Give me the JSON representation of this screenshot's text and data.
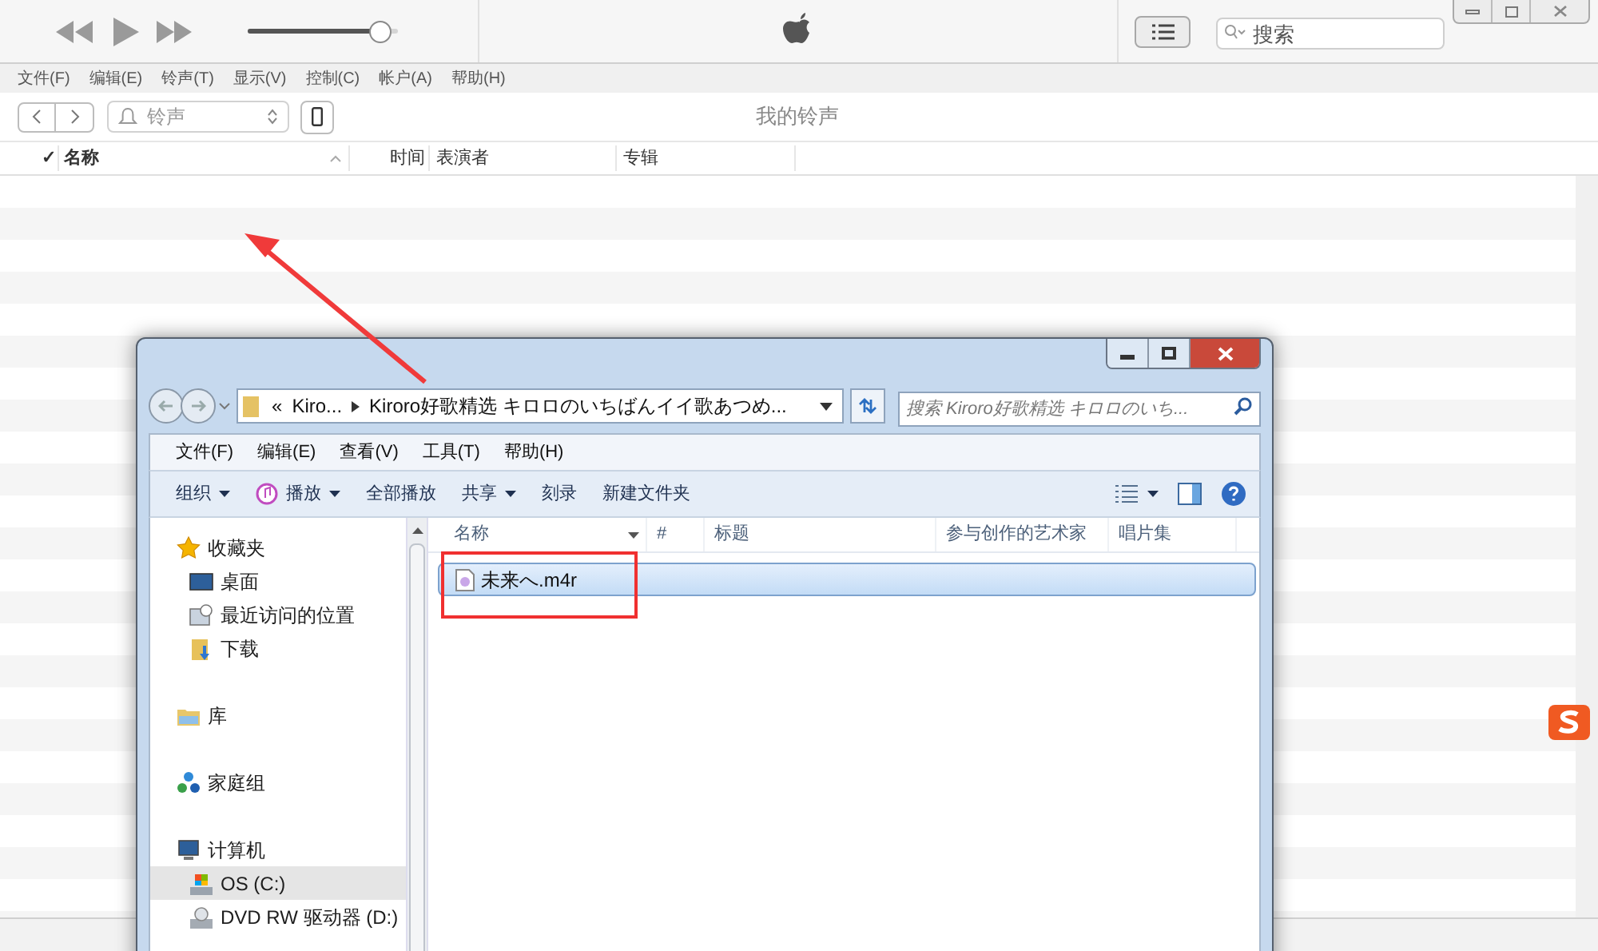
{
  "itunes": {
    "volume": {
      "level": 0.88
    },
    "search": {
      "placeholder": "搜索"
    },
    "menu": [
      "文件(F)",
      "编辑(E)",
      "铃声(T)",
      "显示(V)",
      "控制(C)",
      "帐户(A)",
      "帮助(H)"
    ],
    "source": "铃声",
    "title": "我的铃声",
    "columns": [
      {
        "label": "✓",
        "kind": "check"
      },
      {
        "label": "名称",
        "kind": "sorted"
      },
      {
        "label": "时间",
        "kind": "right"
      },
      {
        "label": "表演者",
        "kind": "plain"
      },
      {
        "label": "专辑",
        "kind": "plain"
      }
    ]
  },
  "explorer": {
    "breadcrumb": [
      "«",
      "Kiro...",
      "Kiroro好歌精选 キロロのいちばんイイ歌あつめ..."
    ],
    "search": {
      "placeholder": "搜索 Kiroro好歌精选 キロロのいち..."
    },
    "menu": [
      "文件(F)",
      "编辑(E)",
      "查看(V)",
      "工具(T)",
      "帮助(H)"
    ],
    "toolbar": [
      {
        "label": "组织",
        "has_menu": true,
        "kind": "plain"
      },
      {
        "label": "播放",
        "has_menu": true,
        "kind": "music"
      },
      {
        "label": "全部播放",
        "has_menu": false,
        "kind": "plain"
      },
      {
        "label": "共享",
        "has_menu": true,
        "kind": "plain"
      },
      {
        "label": "刻录",
        "has_menu": false,
        "kind": "plain"
      },
      {
        "label": "新建文件夹",
        "has_menu": false,
        "kind": "plain"
      }
    ],
    "nav": [
      {
        "label": "收藏夹",
        "kind": "star",
        "selected": false,
        "children": [
          {
            "label": "桌面",
            "kind": "desktop",
            "selected": false
          },
          {
            "label": "最近访问的位置",
            "kind": "recent",
            "selected": false
          },
          {
            "label": "下载",
            "kind": "download",
            "selected": false
          }
        ]
      },
      {
        "label": "库",
        "kind": "library",
        "selected": false
      },
      {
        "label": "家庭组",
        "kind": "homegroup",
        "selected": false
      },
      {
        "label": "计算机",
        "kind": "computer",
        "selected": false,
        "children": [
          {
            "label": "OS (C:)",
            "kind": "drive",
            "selected": true
          },
          {
            "label": "DVD RW 驱动器 (D:)",
            "kind": "dvd",
            "selected": false
          }
        ]
      }
    ],
    "columns": [
      "名称",
      "#",
      "标题",
      "参与创作的艺术家",
      "唱片集"
    ],
    "files": [
      {
        "name": "未来へ.m4r",
        "selected": true
      }
    ]
  }
}
